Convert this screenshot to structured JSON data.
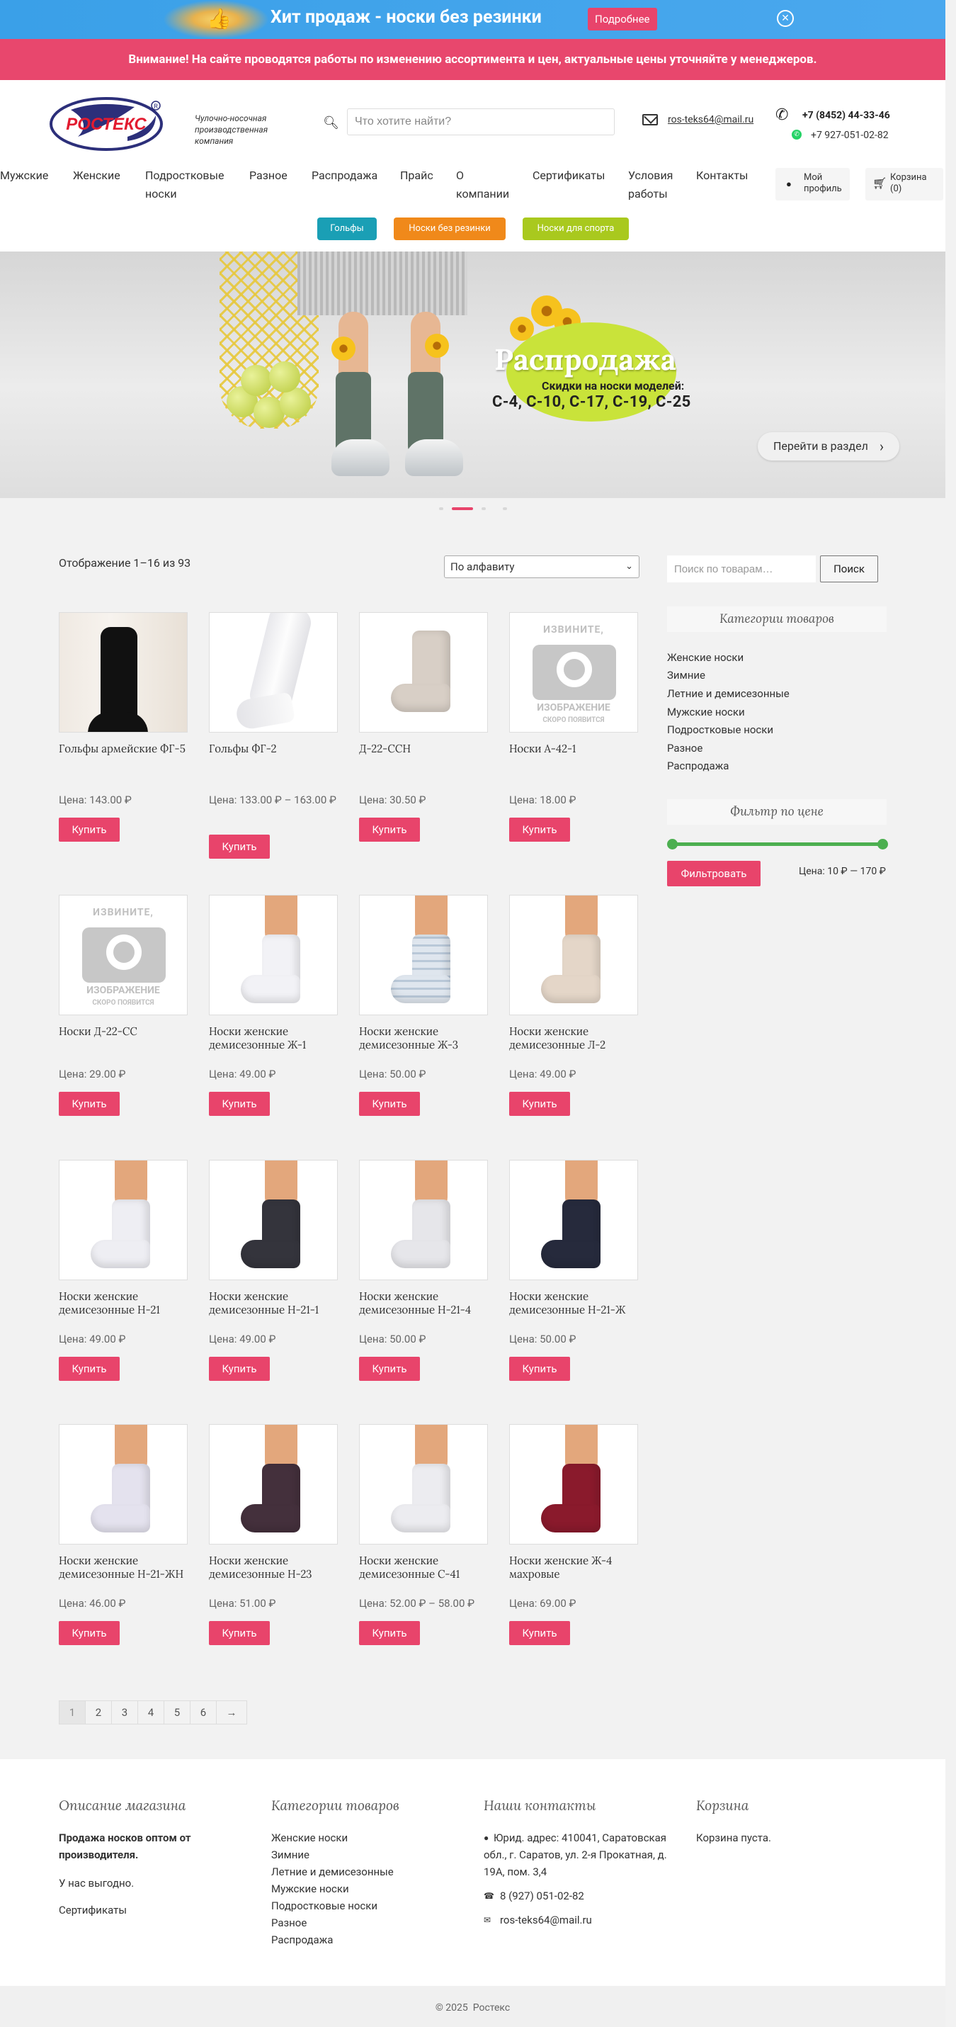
{
  "promo": {
    "title": "Хит продаж - носки без резинки",
    "button": "Подробнее",
    "close_icon": "close-circle-icon"
  },
  "notice": {
    "text": "Внимание! На сайте проводятся работы по изменению ассортимента и цен, актуальные цены уточняйте у менеджеров."
  },
  "header": {
    "logo_text": "РОСТЕКС",
    "tagline": "Чулочно-носочная производственная компания",
    "search_placeholder": "Что хотите найти?",
    "email": "ros-teks64@mail.ru",
    "phone1": "+7 (8452) 44-33-46",
    "phone2": "+7 927-051-02-82"
  },
  "nav": {
    "items": [
      "Мужские",
      "Женские",
      "Подростковые носки",
      "Разное",
      "Распродажа",
      "Прайс",
      "О компании",
      "Сертификаты",
      "Условия работы",
      "Контакты"
    ],
    "profile": "Мой профиль",
    "cart": "Корзина (0)"
  },
  "pills": [
    {
      "label": "Гольфы",
      "color": "#1a9fb5"
    },
    {
      "label": "Носки без резинки",
      "color": "#f0891a"
    },
    {
      "label": "Носки для спорта",
      "color": "#a9c91e"
    }
  ],
  "hero": {
    "title": "Распродажа",
    "subtitle": "Скидки на носки моделей:",
    "models": "С-4, С-10, С-17, С-19, С-25",
    "button": "Перейти в раздел"
  },
  "shop": {
    "result_count": "Отображение 1–16 из 93",
    "orderby": "По алфавиту",
    "products": [
      {
        "title": "Гольфы армейские ФГ-5",
        "price": "Цена: 143.00 ₽",
        "buy": "Купить"
      },
      {
        "title": "Гольфы ФГ-2",
        "price": "Цена: 133.00 ₽ – 163.00 ₽",
        "buy": "Купить"
      },
      {
        "title": "Д-22-ССН",
        "price": "Цена: 30.50 ₽",
        "buy": "Купить"
      },
      {
        "title": "Носки А-42-1",
        "price": "Цена: 18.00 ₽",
        "buy": "Купить"
      },
      {
        "title": "Носки Д-22-СС",
        "price": "Цена: 29.00 ₽",
        "buy": "Купить"
      },
      {
        "title": "Носки женские демисезонные Ж-1",
        "price": "Цена: 49.00 ₽",
        "buy": "Купить"
      },
      {
        "title": "Носки женские демисезонные Ж-3",
        "price": "Цена: 50.00 ₽",
        "buy": "Купить"
      },
      {
        "title": "Носки женские демисезонные Л-2",
        "price": "Цена: 49.00 ₽",
        "buy": "Купить"
      },
      {
        "title": "Носки женские демисезонные Н-21",
        "price": "Цена: 49.00 ₽",
        "buy": "Купить"
      },
      {
        "title": "Носки женские демисезонные Н-21-1",
        "price": "Цена: 49.00 ₽",
        "buy": "Купить"
      },
      {
        "title": "Носки женские демисезонные Н-21-4",
        "price": "Цена: 50.00 ₽",
        "buy": "Купить"
      },
      {
        "title": "Носки женские демисезонные Н-21-Ж",
        "price": "Цена: 50.00 ₽",
        "buy": "Купить"
      },
      {
        "title": "Носки женские демисезонные Н-21-ЖН",
        "price": "Цена: 46.00 ₽",
        "buy": "Купить"
      },
      {
        "title": "Носки женские демисезонные Н-23",
        "price": "Цена: 51.00 ₽",
        "buy": "Купить"
      },
      {
        "title": "Носки женские демисезонные С-41",
        "price": "Цена: 52.00 ₽ – 58.00 ₽",
        "buy": "Купить"
      },
      {
        "title": "Носки женские Ж-4 махровые",
        "price": "Цена: 69.00 ₽",
        "buy": "Купить"
      }
    ],
    "placeholder": {
      "line1": "ИЗВИНИТЕ,",
      "line2": "ИЗОБРАЖЕНИЕ",
      "line3": "СКОРО ПОЯВИТСЯ"
    },
    "pagination": [
      "1",
      "2",
      "3",
      "4",
      "5",
      "6",
      "→"
    ]
  },
  "sidebar": {
    "search_placeholder": "Поиск по товарам…",
    "search_button": "Поиск",
    "categories_title": "Категории товаров",
    "categories": [
      "Женские носки",
      "Зимние",
      "Летние и демисезонные",
      "Мужские носки",
      "Подростковые носки",
      "Разное",
      "Распродажа"
    ],
    "filter_title": "Фильтр по цене",
    "filter_button": "Фильтровать",
    "price_range": "Цена: 10 ₽ — 170 ₽"
  },
  "footer": {
    "about_title": "Описание магазина",
    "about_bold": "Продажа носков оптом от производителя.",
    "about_text": "У нас выгодно.",
    "about_link": "Сертификаты",
    "cats_title": "Категории товаров",
    "cats": [
      "Женские носки",
      "Зимние",
      "Летние и демисезонные",
      "Мужские носки",
      "Подростковые носки",
      "Разное",
      "Распродажа"
    ],
    "contacts_title": "Наши контакты",
    "address": "Юрид. адрес: 410041, Саратовская обл., г. Саратов, ул. 2-я Прокатная, д. 19А, пом. 3,4",
    "phone": "8 (927) 051-02-82",
    "email": "ros-teks64@mail.ru",
    "cart_title": "Корзина",
    "cart_text": "Корзина пуста.",
    "copyright_prefix": "© 2025",
    "copyright_brand": "Ростекс"
  }
}
